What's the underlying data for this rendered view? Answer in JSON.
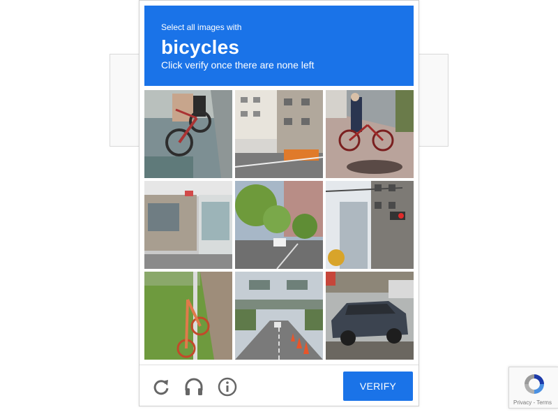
{
  "challenge": {
    "intro": "Select all images with",
    "keyword": "bicycles",
    "subtext": "Click verify once there are none left",
    "header_color": "#1a73e8"
  },
  "tiles": [
    {
      "description_icon": "bicycle-rider-photo"
    },
    {
      "description_icon": "building-street-photo"
    },
    {
      "description_icon": "cyclist-sidewalk-photo"
    },
    {
      "description_icon": "shopfront-photo"
    },
    {
      "description_icon": "trees-street-photo"
    },
    {
      "description_icon": "traffic-light-photo"
    },
    {
      "description_icon": "parked-bicycle-photo"
    },
    {
      "description_icon": "highway-cones-photo"
    },
    {
      "description_icon": "parked-car-photo"
    }
  ],
  "footer": {
    "reload_icon": "reload-icon",
    "audio_icon": "headphones-icon",
    "info_icon": "info-icon",
    "verify_label": "VERIFY",
    "verify_color": "#1a73e8"
  },
  "badge": {
    "links": "Privacy - Terms"
  }
}
